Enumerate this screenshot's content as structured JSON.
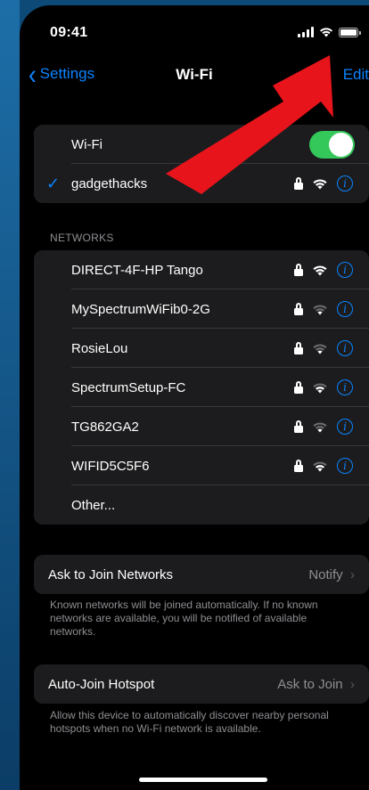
{
  "status_bar": {
    "time": "09:41"
  },
  "nav": {
    "back_label": "Settings",
    "title": "Wi-Fi",
    "edit_label": "Edit"
  },
  "wifi": {
    "toggle_label": "Wi-Fi",
    "toggle_on": true,
    "connected_network": "gadgethacks"
  },
  "networks": {
    "header": "NETWORKS",
    "items": [
      {
        "name": "DIRECT-4F-HP Tango",
        "secured": true,
        "signal": "full"
      },
      {
        "name": "MySpectrumWiFib0-2G",
        "secured": true,
        "signal": "weak"
      },
      {
        "name": "RosieLou",
        "secured": true,
        "signal": "weak"
      },
      {
        "name": "SpectrumSetup-FC",
        "secured": true,
        "signal": "medium"
      },
      {
        "name": "TG862GA2",
        "secured": true,
        "signal": "weak"
      },
      {
        "name": "WIFID5C5F6",
        "secured": true,
        "signal": "medium"
      }
    ],
    "other_label": "Other..."
  },
  "ask_to_join": {
    "label": "Ask to Join Networks",
    "value": "Notify",
    "note": "Known networks will be joined automatically. If no known networks are available, you will be notified of available networks."
  },
  "auto_join_hotspot": {
    "label": "Auto-Join Hotspot",
    "value": "Ask to Join",
    "note": "Allow this device to automatically discover nearby personal hotspots when no Wi-Fi network is available."
  },
  "colors": {
    "accent": "#0a84ff",
    "toggle_on": "#34c759",
    "annotation_arrow": "#e8141b"
  },
  "icons": {
    "back": "chevron-left-icon",
    "check": "checkmark-icon",
    "lock": "lock-icon",
    "wifi": "wifi-icon",
    "info": "info-icon",
    "disclosure": "chevron-right-icon"
  }
}
